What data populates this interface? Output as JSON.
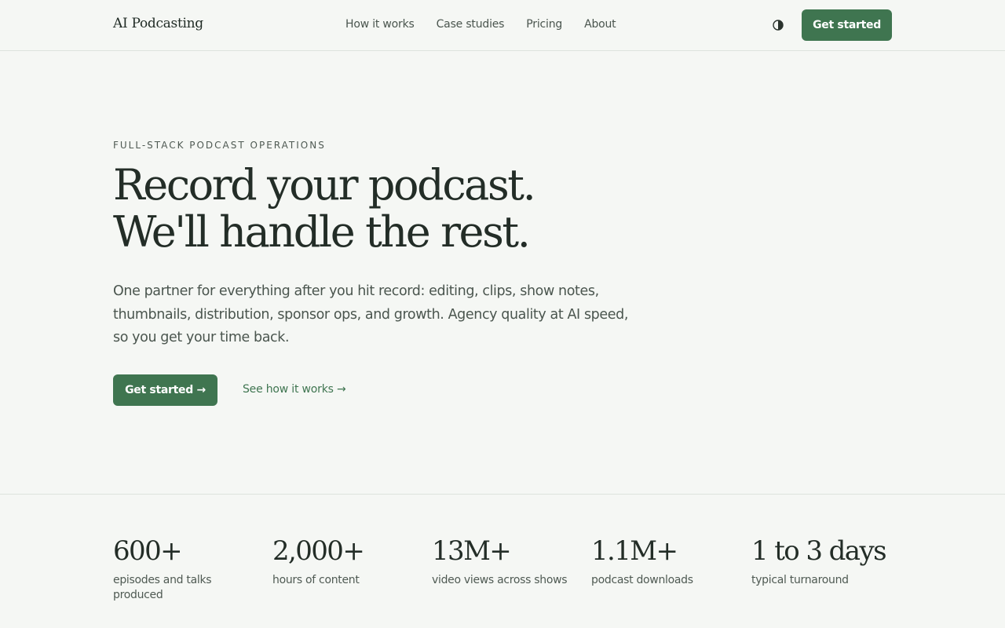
{
  "header": {
    "logo": "AI Podcasting",
    "nav": [
      "How it works",
      "Case studies",
      "Pricing",
      "About"
    ],
    "theme_toggle_icon": "contrast-icon",
    "cta_label": "Get started"
  },
  "hero": {
    "eyebrow": "FULL-STACK PODCAST OPERATIONS",
    "headline_line1": "Record your podcast.",
    "headline_line2": "We'll handle the rest.",
    "lead": "One partner for everything after you hit record: editing, clips, show notes, thumbnails, distribution, sponsor ops, and growth. Agency quality at AI speed, so you get your time back.",
    "primary_cta": "Get started →",
    "secondary_cta": "See how it works →"
  },
  "stats": [
    {
      "value": "600+",
      "label": "episodes and talks produced"
    },
    {
      "value": "2,000+",
      "label": "hours of content"
    },
    {
      "value": "13M+",
      "label": "video views across shows"
    },
    {
      "value": "1.1M+",
      "label": "podcast downloads"
    },
    {
      "value": "1 to 3 days",
      "label": "typical turnaround"
    }
  ],
  "colors": {
    "accent": "#3f7550",
    "background": "#f5f7f4",
    "text": "#232d27"
  }
}
